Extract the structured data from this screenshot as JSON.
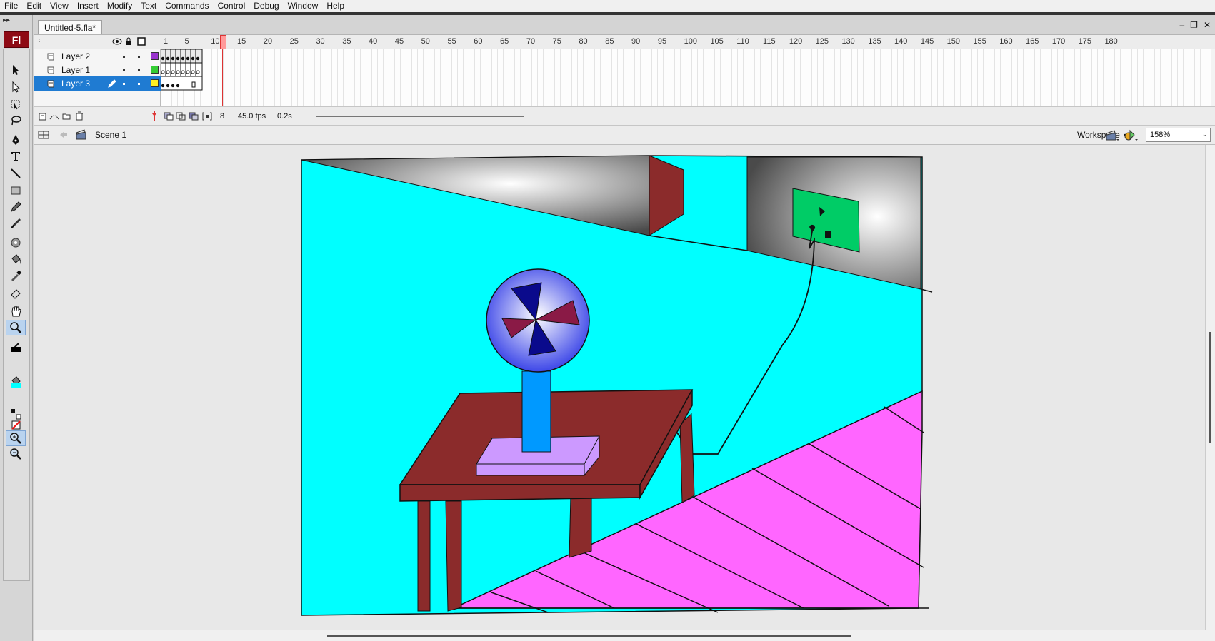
{
  "menu": [
    "File",
    "Edit",
    "View",
    "Insert",
    "Modify",
    "Text",
    "Commands",
    "Control",
    "Debug",
    "Window",
    "Help"
  ],
  "app_logo": "Fl",
  "document": {
    "tab_title": "Untitled-5.fla*"
  },
  "timeline": {
    "frame_ticks": [
      "1",
      "5",
      "10",
      "15",
      "20",
      "25",
      "30",
      "35",
      "40",
      "45",
      "50",
      "55",
      "60",
      "65",
      "70",
      "75",
      "80",
      "85",
      "90",
      "95",
      "100",
      "105",
      "110",
      "115",
      "120",
      "125",
      "130",
      "135",
      "140",
      "145",
      "150",
      "155",
      "160",
      "165",
      "170",
      "175",
      "180"
    ],
    "layers": [
      {
        "name": "Layer 2",
        "color": "#9933cc",
        "active": false
      },
      {
        "name": "Layer 1",
        "color": "#33cc33",
        "active": false
      },
      {
        "name": "Layer 3",
        "color": "#ffee22",
        "active": true
      }
    ],
    "current_frame": "8",
    "fps": "45.0 fps",
    "elapsed": "0.2s"
  },
  "editbar": {
    "scene": "Scene 1",
    "workspace_label": "Workspace",
    "zoom": "158%"
  },
  "colors": {
    "wall": "#00ffff",
    "floor": "#ff66ff",
    "table": "#8b2b2b",
    "fan_stand": "#0099ff",
    "fan_base": "#cc99ff",
    "outlet": "#00cc66",
    "accent": "#1f7bd2"
  }
}
